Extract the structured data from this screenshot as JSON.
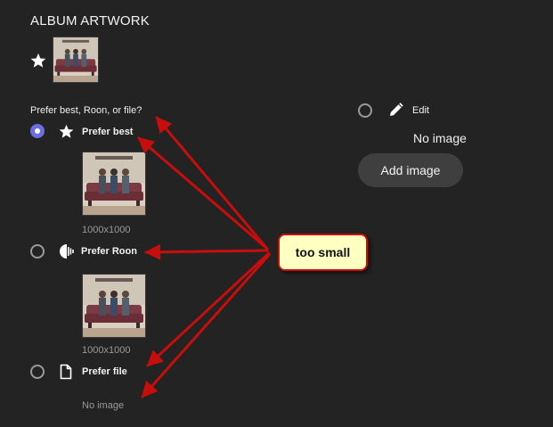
{
  "section": {
    "title": "ALBUM ARTWORK"
  },
  "question": "Prefer best, Roon, or file?",
  "options": [
    {
      "label": "Prefer best",
      "selected": true,
      "icon": "star-icon",
      "dimensions": "1000x1000"
    },
    {
      "label": "Prefer Roon",
      "selected": false,
      "icon": "roon-icon",
      "dimensions": "1000x1000"
    },
    {
      "label": "Prefer file",
      "selected": false,
      "icon": "file-icon",
      "status": "No image"
    }
  ],
  "edit": {
    "label": "Edit",
    "icon": "pencil-icon",
    "selected": false,
    "status": "No image",
    "add_button": "Add image"
  },
  "annotation": {
    "callout": "too small"
  },
  "colors": {
    "background": "#232323",
    "accent": "#6b6fe0",
    "annotation_red": "#c80d0d",
    "callout_fill": "#ffffc2",
    "button_bg": "#3f3f3f"
  }
}
